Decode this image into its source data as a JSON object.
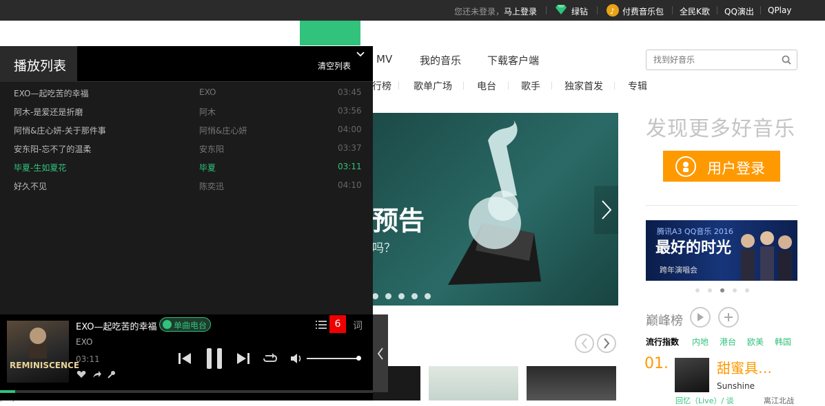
{
  "topbar": {
    "login_prompt": "您还未登录，",
    "login_link": "马上登录",
    "green_diamond": "绿钻",
    "paid_pack": "付费音乐包",
    "karaoke": "全民K歌",
    "live": "QQ演出",
    "qplay": "QPlay"
  },
  "nav": {
    "mv": "MV",
    "my_music": "我的音乐",
    "download": "下载客户端",
    "sub_items": [
      "行榜",
      "歌单广场",
      "电台",
      "歌手",
      "独家首发",
      "专辑"
    ]
  },
  "search": {
    "placeholder": "找到好音乐"
  },
  "banner": {
    "headline": "预告",
    "subline": "吗？"
  },
  "sidebar": {
    "discover": "发现更多好音乐",
    "login_button": "用户登录",
    "promo_top": "腾讯A3 QQ音乐 2016",
    "promo_main": "最好的时光",
    "promo_sub": "跨年演唱会"
  },
  "chart": {
    "title": "巅峰榜",
    "tabs": [
      "流行指数",
      "内地",
      "港台",
      "欧美",
      "韩国"
    ],
    "rank1_num": "01.",
    "rank1_title": "甜蜜具…",
    "rank1_artist": "Sunshine",
    "rank2_title": "回忆（Live）/ 谈",
    "rank2_artist": "离江北战"
  },
  "playlist": {
    "title": "播放列表",
    "clear": "清空列表",
    "tracks": [
      {
        "title": "EXO—起吃苦的幸福",
        "artist": "EXO",
        "duration": "03:45",
        "active": false
      },
      {
        "title": "阿木-是爱还是折磨",
        "artist": "阿木",
        "duration": "03:56",
        "active": false
      },
      {
        "title": "阿悄&庄心妍-关于那件事",
        "artist": "阿悄&庄心妍",
        "duration": "04:00",
        "active": false
      },
      {
        "title": "安东阳-忘不了的温柔",
        "artist": "安东阳",
        "duration": "03:37",
        "active": false
      },
      {
        "title": "毕夏-生如夏花",
        "artist": "毕夏",
        "duration": "03:11",
        "active": true
      },
      {
        "title": "好久不见",
        "artist": "陈奕迅",
        "duration": "04:10",
        "active": false
      }
    ],
    "label_below": "play list"
  },
  "player": {
    "song": "EXO—起吃苦的幸福",
    "radio": "单曲电台",
    "artist": "EXO",
    "time": "03:11",
    "count": "6",
    "lyric": "词",
    "cover_text": "REMINISCENCE",
    "progress": 0.04,
    "volume": 1.0
  },
  "colors": {
    "accent": "#31c27c",
    "orange": "#ff9900",
    "alert": "#ee0000"
  }
}
